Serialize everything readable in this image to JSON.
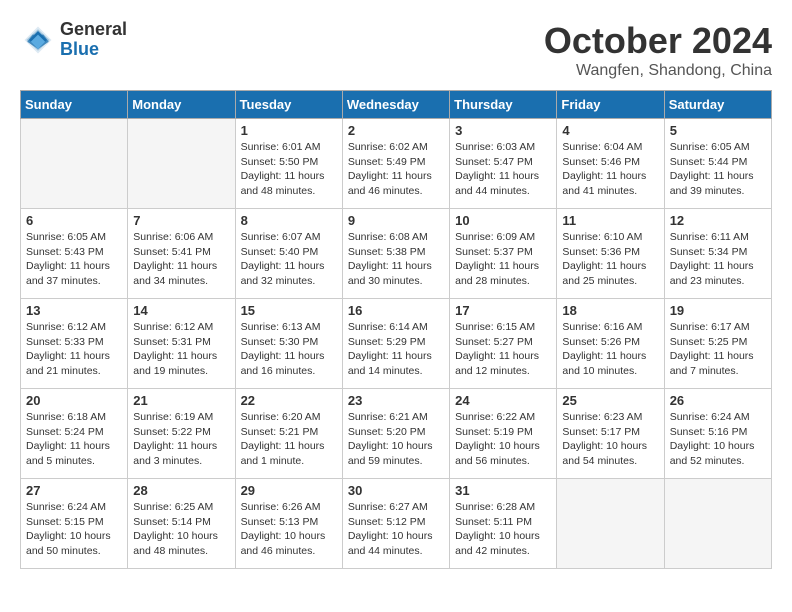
{
  "header": {
    "logo_general": "General",
    "logo_blue": "Blue",
    "month": "October 2024",
    "location": "Wangfen, Shandong, China"
  },
  "weekdays": [
    "Sunday",
    "Monday",
    "Tuesday",
    "Wednesday",
    "Thursday",
    "Friday",
    "Saturday"
  ],
  "weeks": [
    [
      {
        "day": "",
        "empty": true
      },
      {
        "day": "",
        "empty": true
      },
      {
        "day": "1",
        "sunrise": "Sunrise: 6:01 AM",
        "sunset": "Sunset: 5:50 PM",
        "daylight": "Daylight: 11 hours and 48 minutes."
      },
      {
        "day": "2",
        "sunrise": "Sunrise: 6:02 AM",
        "sunset": "Sunset: 5:49 PM",
        "daylight": "Daylight: 11 hours and 46 minutes."
      },
      {
        "day": "3",
        "sunrise": "Sunrise: 6:03 AM",
        "sunset": "Sunset: 5:47 PM",
        "daylight": "Daylight: 11 hours and 44 minutes."
      },
      {
        "day": "4",
        "sunrise": "Sunrise: 6:04 AM",
        "sunset": "Sunset: 5:46 PM",
        "daylight": "Daylight: 11 hours and 41 minutes."
      },
      {
        "day": "5",
        "sunrise": "Sunrise: 6:05 AM",
        "sunset": "Sunset: 5:44 PM",
        "daylight": "Daylight: 11 hours and 39 minutes."
      }
    ],
    [
      {
        "day": "6",
        "sunrise": "Sunrise: 6:05 AM",
        "sunset": "Sunset: 5:43 PM",
        "daylight": "Daylight: 11 hours and 37 minutes."
      },
      {
        "day": "7",
        "sunrise": "Sunrise: 6:06 AM",
        "sunset": "Sunset: 5:41 PM",
        "daylight": "Daylight: 11 hours and 34 minutes."
      },
      {
        "day": "8",
        "sunrise": "Sunrise: 6:07 AM",
        "sunset": "Sunset: 5:40 PM",
        "daylight": "Daylight: 11 hours and 32 minutes."
      },
      {
        "day": "9",
        "sunrise": "Sunrise: 6:08 AM",
        "sunset": "Sunset: 5:38 PM",
        "daylight": "Daylight: 11 hours and 30 minutes."
      },
      {
        "day": "10",
        "sunrise": "Sunrise: 6:09 AM",
        "sunset": "Sunset: 5:37 PM",
        "daylight": "Daylight: 11 hours and 28 minutes."
      },
      {
        "day": "11",
        "sunrise": "Sunrise: 6:10 AM",
        "sunset": "Sunset: 5:36 PM",
        "daylight": "Daylight: 11 hours and 25 minutes."
      },
      {
        "day": "12",
        "sunrise": "Sunrise: 6:11 AM",
        "sunset": "Sunset: 5:34 PM",
        "daylight": "Daylight: 11 hours and 23 minutes."
      }
    ],
    [
      {
        "day": "13",
        "sunrise": "Sunrise: 6:12 AM",
        "sunset": "Sunset: 5:33 PM",
        "daylight": "Daylight: 11 hours and 21 minutes."
      },
      {
        "day": "14",
        "sunrise": "Sunrise: 6:12 AM",
        "sunset": "Sunset: 5:31 PM",
        "daylight": "Daylight: 11 hours and 19 minutes."
      },
      {
        "day": "15",
        "sunrise": "Sunrise: 6:13 AM",
        "sunset": "Sunset: 5:30 PM",
        "daylight": "Daylight: 11 hours and 16 minutes."
      },
      {
        "day": "16",
        "sunrise": "Sunrise: 6:14 AM",
        "sunset": "Sunset: 5:29 PM",
        "daylight": "Daylight: 11 hours and 14 minutes."
      },
      {
        "day": "17",
        "sunrise": "Sunrise: 6:15 AM",
        "sunset": "Sunset: 5:27 PM",
        "daylight": "Daylight: 11 hours and 12 minutes."
      },
      {
        "day": "18",
        "sunrise": "Sunrise: 6:16 AM",
        "sunset": "Sunset: 5:26 PM",
        "daylight": "Daylight: 11 hours and 10 minutes."
      },
      {
        "day": "19",
        "sunrise": "Sunrise: 6:17 AM",
        "sunset": "Sunset: 5:25 PM",
        "daylight": "Daylight: 11 hours and 7 minutes."
      }
    ],
    [
      {
        "day": "20",
        "sunrise": "Sunrise: 6:18 AM",
        "sunset": "Sunset: 5:24 PM",
        "daylight": "Daylight: 11 hours and 5 minutes."
      },
      {
        "day": "21",
        "sunrise": "Sunrise: 6:19 AM",
        "sunset": "Sunset: 5:22 PM",
        "daylight": "Daylight: 11 hours and 3 minutes."
      },
      {
        "day": "22",
        "sunrise": "Sunrise: 6:20 AM",
        "sunset": "Sunset: 5:21 PM",
        "daylight": "Daylight: 11 hours and 1 minute."
      },
      {
        "day": "23",
        "sunrise": "Sunrise: 6:21 AM",
        "sunset": "Sunset: 5:20 PM",
        "daylight": "Daylight: 10 hours and 59 minutes."
      },
      {
        "day": "24",
        "sunrise": "Sunrise: 6:22 AM",
        "sunset": "Sunset: 5:19 PM",
        "daylight": "Daylight: 10 hours and 56 minutes."
      },
      {
        "day": "25",
        "sunrise": "Sunrise: 6:23 AM",
        "sunset": "Sunset: 5:17 PM",
        "daylight": "Daylight: 10 hours and 54 minutes."
      },
      {
        "day": "26",
        "sunrise": "Sunrise: 6:24 AM",
        "sunset": "Sunset: 5:16 PM",
        "daylight": "Daylight: 10 hours and 52 minutes."
      }
    ],
    [
      {
        "day": "27",
        "sunrise": "Sunrise: 6:24 AM",
        "sunset": "Sunset: 5:15 PM",
        "daylight": "Daylight: 10 hours and 50 minutes."
      },
      {
        "day": "28",
        "sunrise": "Sunrise: 6:25 AM",
        "sunset": "Sunset: 5:14 PM",
        "daylight": "Daylight: 10 hours and 48 minutes."
      },
      {
        "day": "29",
        "sunrise": "Sunrise: 6:26 AM",
        "sunset": "Sunset: 5:13 PM",
        "daylight": "Daylight: 10 hours and 46 minutes."
      },
      {
        "day": "30",
        "sunrise": "Sunrise: 6:27 AM",
        "sunset": "Sunset: 5:12 PM",
        "daylight": "Daylight: 10 hours and 44 minutes."
      },
      {
        "day": "31",
        "sunrise": "Sunrise: 6:28 AM",
        "sunset": "Sunset: 5:11 PM",
        "daylight": "Daylight: 10 hours and 42 minutes."
      },
      {
        "day": "",
        "empty": true
      },
      {
        "day": "",
        "empty": true
      }
    ]
  ]
}
